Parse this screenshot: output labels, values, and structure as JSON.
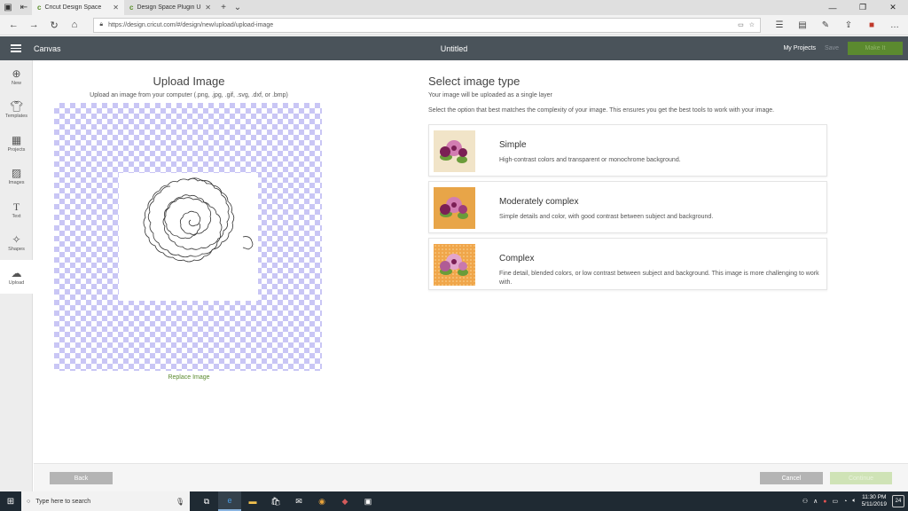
{
  "browser": {
    "tabs": [
      {
        "label": "Cricut Design Space",
        "active": true
      },
      {
        "label": "Design Space Plugin Updat",
        "active": false
      }
    ],
    "url": "https://design.cricut.com/#/design/new/upload/upload-image"
  },
  "header": {
    "canvas_label": "Canvas",
    "doc_title": "Untitled",
    "my_projects": "My Projects",
    "save": "Save",
    "make_it": "Make It"
  },
  "sidebar": {
    "items": [
      {
        "label": "New",
        "icon": "plus-circle-icon"
      },
      {
        "label": "Templates",
        "icon": "shirt-icon"
      },
      {
        "label": "Projects",
        "icon": "projects-icon"
      },
      {
        "label": "Images",
        "icon": "image-icon"
      },
      {
        "label": "Text",
        "icon": "text-icon"
      },
      {
        "label": "Shapes",
        "icon": "shapes-icon"
      },
      {
        "label": "Upload",
        "icon": "cloud-upload-icon"
      }
    ]
  },
  "upload": {
    "title": "Upload Image",
    "subtitle": "Upload an image from your computer (.png, .jpg, .gif, .svg, .dxf, or .bmp)",
    "replace": "Replace Image"
  },
  "select": {
    "title": "Select image type",
    "sub1": "Your image will be uploaded as a single layer",
    "sub2": "Select the option that best matches the complexity of your image. This ensures you get the best tools to work with your image.",
    "options": [
      {
        "title": "Simple",
        "desc": "High-contrast colors and transparent or monochrome background."
      },
      {
        "title": "Moderately complex",
        "desc": "Simple details and color, with good contrast between subject and background."
      },
      {
        "title": "Complex",
        "desc": "Fine detail, blended colors, or low contrast between subject and background. This image is more challenging to work with."
      }
    ]
  },
  "footer": {
    "back": "Back",
    "cancel": "Cancel",
    "continue": "Continue"
  },
  "taskbar": {
    "search_placeholder": "Type here to search",
    "time": "11:30 PM",
    "date": "5/11/2019",
    "notif_count": "24"
  },
  "colors": {
    "accent_green": "#5b8a2f",
    "header_bg": "#4a535a",
    "checker": "#c9c6f5"
  }
}
